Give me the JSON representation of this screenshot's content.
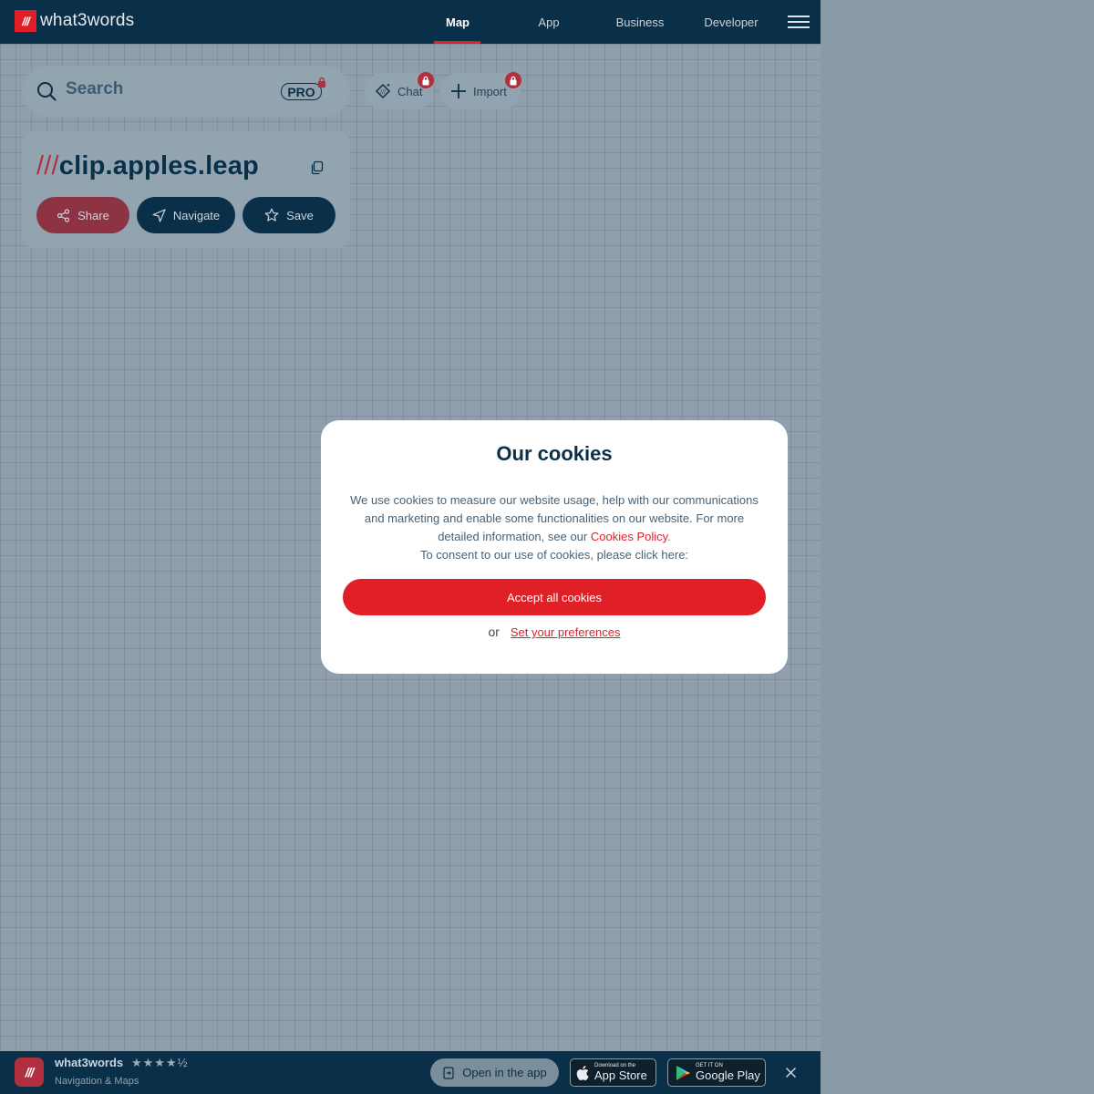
{
  "header": {
    "logo_mark": "///",
    "logo_text": "what3words",
    "nav": [
      "Map",
      "App",
      "Business",
      "Developer"
    ],
    "active_nav": "Map"
  },
  "search": {
    "placeholder": "Search",
    "pro_label": "PRO"
  },
  "actions": {
    "chat_label": "Chat",
    "import_label": "Import"
  },
  "address_card": {
    "slashes": "///",
    "words": "clip.apples.leap",
    "share_label": "Share",
    "navigate_label": "Navigate",
    "save_label": "Save"
  },
  "cookies": {
    "title": "Our cookies",
    "body": "We use cookies to measure our website usage, help with our communications and marketing and enable some functionalities on our website. For more detailed information, see our",
    "policy_link": "Cookies Policy",
    "consent_text": "To consent to our use of cookies, please click here:",
    "accept_label": "Accept all cookies",
    "or_text": "or",
    "preferences_link": "Set your preferences"
  },
  "banner": {
    "app_mark": "///",
    "app_name": "what3words",
    "rating_stars": "★★★★½",
    "subtitle": "Navigation & Maps",
    "open_app_label": "Open in the app",
    "app_store_small": "Download on the",
    "app_store_big": "App Store",
    "google_play_small": "GET IT ON",
    "google_play_big": "Google Play"
  },
  "colors": {
    "brand_red": "#e11f26",
    "navy": "#0a3049"
  }
}
